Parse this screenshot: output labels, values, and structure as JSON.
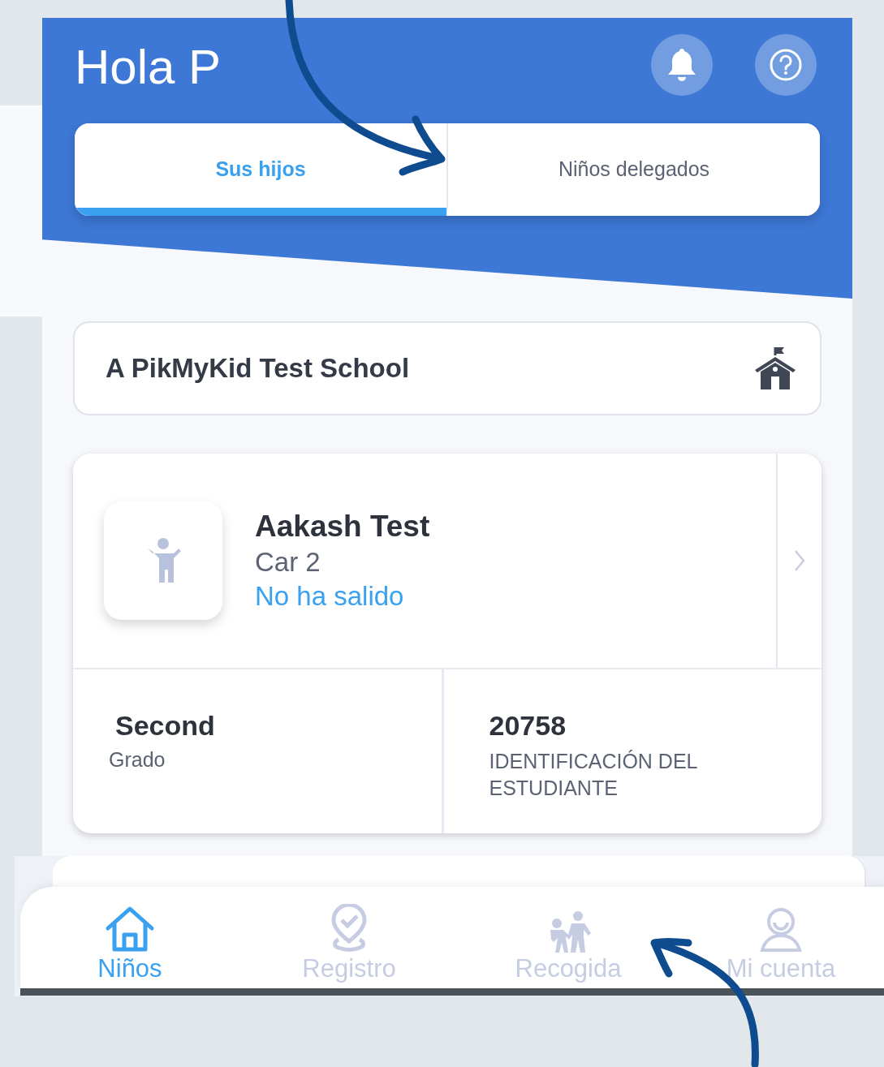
{
  "header": {
    "greeting": "Hola P"
  },
  "tabs": [
    {
      "label": "Sus hijos",
      "selected": true
    },
    {
      "label": "Niños delegados",
      "selected": false
    }
  ],
  "school": {
    "name": "A PikMyKid Test School"
  },
  "students": [
    {
      "name": "Aakash Test",
      "car": "Car 2",
      "status": "No ha salido",
      "grade": "Second",
      "grade_label": "Grado",
      "id": "20758",
      "id_label": "IDENTIFICACIÓN DEL ESTUDIANTE"
    }
  ],
  "nav": [
    {
      "label": "Niños",
      "kind": "home",
      "selected": true
    },
    {
      "label": "Registro",
      "kind": "checkin",
      "selected": false
    },
    {
      "label": "Recogida",
      "kind": "pickup",
      "selected": false
    },
    {
      "label": "Mi cuenta",
      "kind": "account",
      "selected": false
    }
  ]
}
